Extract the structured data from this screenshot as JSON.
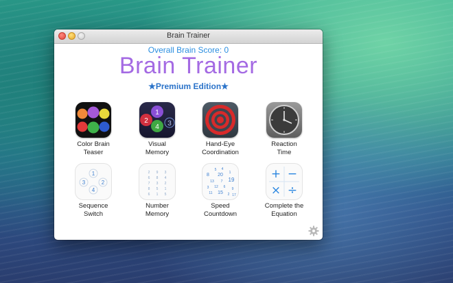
{
  "window": {
    "title": "Brain Trainer"
  },
  "header": {
    "score_text": "Overall Brain Score: 0",
    "app_title": "Brain Trainer",
    "edition": "★Premium Edition★"
  },
  "games": [
    {
      "line1": "Color Brain",
      "line2": "Teaser",
      "icon": "color-circles-icon"
    },
    {
      "line1": "Visual",
      "line2": "Memory",
      "icon": "numbered-circles-icon"
    },
    {
      "line1": "Hand-Eye",
      "line2": "Coordination",
      "icon": "target-icon"
    },
    {
      "line1": "Reaction",
      "line2": "Time",
      "icon": "clock-icon"
    },
    {
      "line1": "Sequence",
      "line2": "Switch",
      "icon": "sequence-icon"
    },
    {
      "line1": "Number",
      "line2": "Memory",
      "icon": "number-grid-icon"
    },
    {
      "line1": "Speed",
      "line2": "Countdown",
      "icon": "scattered-numbers-icon"
    },
    {
      "line1": "Complete the",
      "line2": "Equation",
      "icon": "math-operators-icon"
    }
  ],
  "icon_text": {
    "visual_memory": [
      "1",
      "2",
      "4",
      "3"
    ],
    "sequence": [
      "1",
      "3",
      "2",
      "4"
    ],
    "number_grid": [
      "2",
      "9",
      "3",
      "6",
      "8",
      "4",
      "7",
      "3",
      "2",
      "8",
      "5",
      "1",
      "6",
      "1",
      "5"
    ],
    "speed": [
      "5",
      "4",
      "8",
      "20",
      "1",
      "13",
      "7",
      "19",
      "3",
      "12",
      "6",
      "9",
      "11",
      "15",
      "2",
      "17"
    ],
    "operators": [
      "+",
      "−",
      "×",
      "÷"
    ]
  },
  "colors": {
    "score": "#2a8ee0",
    "title": "#a46ae3",
    "edition": "#2b73c9",
    "operator": "#2a86e0"
  }
}
